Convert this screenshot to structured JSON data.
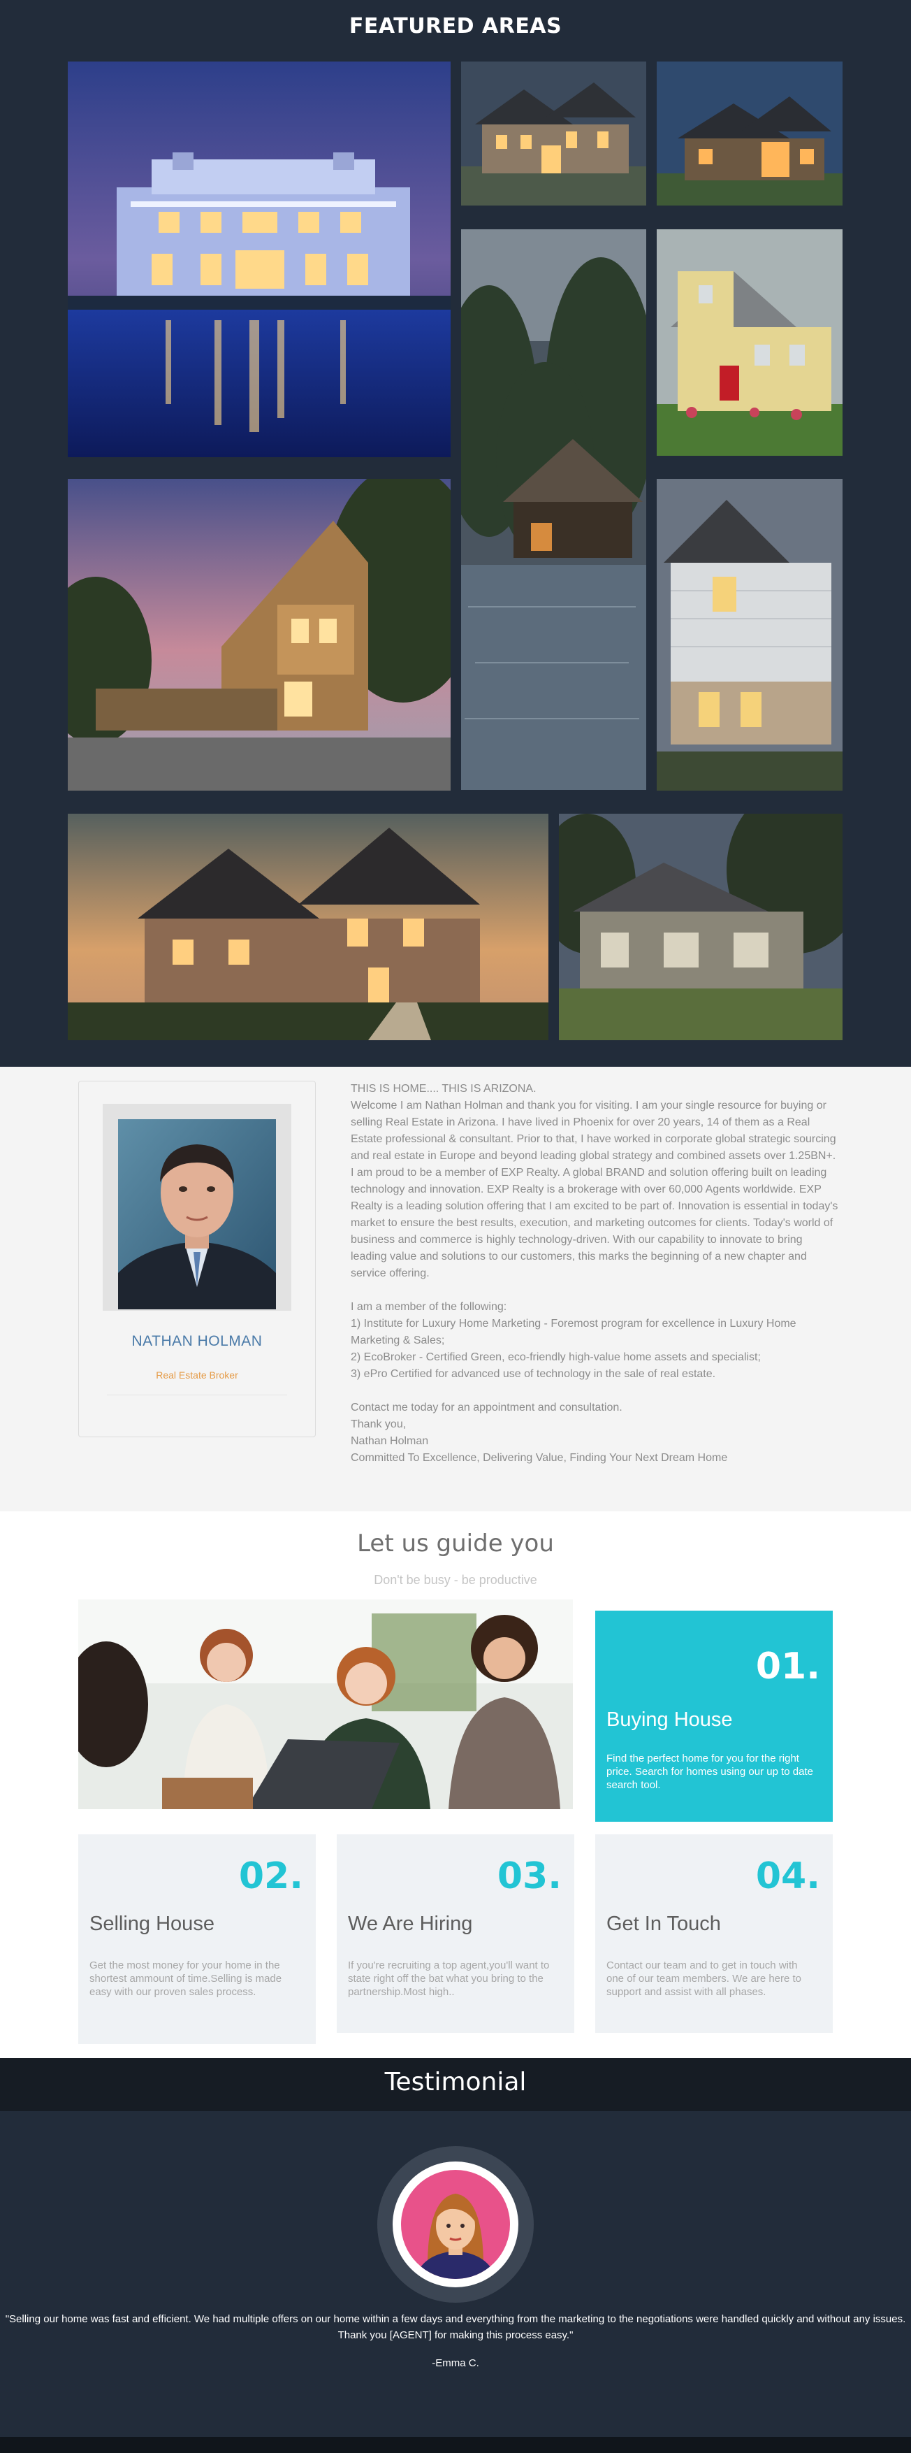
{
  "featured": {
    "title": "FEATURED AREAS"
  },
  "about": {
    "name": "NATHAN HOLMAN",
    "role": "Real Estate Broker",
    "paragraphs": [
      "THIS IS HOME.... THIS IS ARIZONA.\nWelcome I am Nathan Holman and thank you for visiting. I am your single resource for buying or selling Real Estate in Arizona. I have lived in Phoenix for over 20 years, 14 of them as a Real Estate professional & consultant. Prior to that, I have worked in corporate global strategic sourcing and real estate in Europe and beyond leading global strategy and combined assets over 1.25BN+. I am proud to be a member of EXP Realty. A global BRAND and solution offering built on leading technology and innovation. EXP Realty is a brokerage with over 60,000 Agents worldwide. EXP Realty is a leading solution offering that I am excited to be part of. Innovation is essential in today's market to ensure the best results, execution, and marketing outcomes for clients. Today's world of business and commerce is highly technology-driven. With our capability to innovate to bring leading value and solutions to our customers, this marks the beginning of a new chapter and service offering.",
      "I am a member of the following:\n1) Institute for Luxury Home Marketing - Foremost program for excellence in Luxury Home Marketing & Sales;\n2) EcoBroker - Certified Green, eco-friendly high-value home assets and specialist;\n3) ePro Certified for advanced use of technology in the sale of real estate.",
      "Contact me today for an appointment and consultation.\nThank you,\nNathan Holman\nCommitted To Excellence, Delivering Value, Finding Your Next Dream Home"
    ]
  },
  "guide": {
    "title": "Let us guide you",
    "subtitle": "Don't be busy - be productive",
    "cards": [
      {
        "num": "01.",
        "title": "Buying House",
        "text": "Find the perfect home for you for the right price. Search for homes using our up to date search tool."
      },
      {
        "num": "02.",
        "title": "Selling House",
        "text": "Get the most money for your home in the shortest ammount of time.Selling is made easy with our proven sales process."
      },
      {
        "num": "03.",
        "title": "We Are Hiring",
        "text": "If you're recruiting a top agent,you'll want to state right off the bat what you bring to the partnership.Most high.."
      },
      {
        "num": "04.",
        "title": "Get In Touch",
        "text": "Contact our team and to get in touch with one of our team members. We are here to support and assist with all phases."
      }
    ]
  },
  "testimonial": {
    "title": "Testimonial",
    "quote": "\"Selling our home was fast and efficient. We had multiple offers on our home within a few days and everything from the marketing to the negotiations were handled quickly and without any issues. Thank you [AGENT] for making this process easy.\"",
    "author": "-Emma C."
  },
  "colors": {
    "accent": "#22c4d4",
    "dark_bg": "#222c3a",
    "name_blue": "#4a7aa8",
    "role_orange": "#e59b47"
  }
}
